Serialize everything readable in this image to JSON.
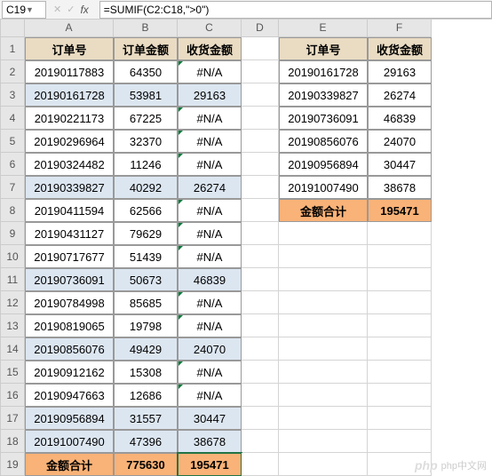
{
  "name_box": "C19",
  "formula": "=SUMIF(C2:C18,\">0\")",
  "cols": [
    "",
    "A",
    "B",
    "C",
    "D",
    "E",
    "F"
  ],
  "rows": [
    "1",
    "2",
    "3",
    "4",
    "5",
    "6",
    "7",
    "8",
    "9",
    "10",
    "11",
    "12",
    "13",
    "14",
    "15",
    "16",
    "17",
    "18",
    "19"
  ],
  "headersA": {
    "A": "订单号",
    "B": "订单金额",
    "C": "收货金额"
  },
  "headersE": {
    "E": "订单号",
    "F": "收货金额"
  },
  "tableA": [
    {
      "a": "20190117883",
      "b": "64350",
      "c": "#N/A",
      "mark": true
    },
    {
      "a": "20190161728",
      "b": "53981",
      "c": "29163",
      "blue": true
    },
    {
      "a": "20190221173",
      "b": "67225",
      "c": "#N/A",
      "mark": true
    },
    {
      "a": "20190296964",
      "b": "32370",
      "c": "#N/A",
      "mark": true
    },
    {
      "a": "20190324482",
      "b": "11246",
      "c": "#N/A",
      "mark": true
    },
    {
      "a": "20190339827",
      "b": "40292",
      "c": "26274",
      "blue": true
    },
    {
      "a": "20190411594",
      "b": "62566",
      "c": "#N/A",
      "mark": true
    },
    {
      "a": "20190431127",
      "b": "79629",
      "c": "#N/A",
      "mark": true
    },
    {
      "a": "20190717677",
      "b": "51439",
      "c": "#N/A",
      "mark": true
    },
    {
      "a": "20190736091",
      "b": "50673",
      "c": "46839",
      "blue": true
    },
    {
      "a": "20190784998",
      "b": "85685",
      "c": "#N/A",
      "mark": true
    },
    {
      "a": "20190819065",
      "b": "19798",
      "c": "#N/A",
      "mark": true
    },
    {
      "a": "20190856076",
      "b": "49429",
      "c": "24070",
      "blue": true
    },
    {
      "a": "20190912162",
      "b": "15308",
      "c": "#N/A",
      "mark": true
    },
    {
      "a": "20190947663",
      "b": "12686",
      "c": "#N/A",
      "mark": true
    },
    {
      "a": "20190956894",
      "b": "31557",
      "c": "30447",
      "blue": true
    },
    {
      "a": "20191007490",
      "b": "47396",
      "c": "38678",
      "blue": true
    }
  ],
  "sumA": {
    "label": "金额合计",
    "b": "775630",
    "c": "195471"
  },
  "tableE": [
    {
      "e": "20190161728",
      "f": "29163"
    },
    {
      "e": "20190339827",
      "f": "26274"
    },
    {
      "e": "20190736091",
      "f": "46839"
    },
    {
      "e": "20190856076",
      "f": "24070"
    },
    {
      "e": "20190956894",
      "f": "30447"
    },
    {
      "e": "20191007490",
      "f": "38678"
    }
  ],
  "sumE": {
    "label": "金额合计",
    "f": "195471"
  },
  "watermark": "php中文网",
  "chart_data": {
    "type": "table",
    "title": "SUMIF example",
    "left_table": {
      "columns": [
        "订单号",
        "订单金额",
        "收货金额"
      ],
      "rows": [
        [
          "20190117883",
          64350,
          null
        ],
        [
          "20190161728",
          53981,
          29163
        ],
        [
          "20190221173",
          67225,
          null
        ],
        [
          "20190296964",
          32370,
          null
        ],
        [
          "20190324482",
          11246,
          null
        ],
        [
          "20190339827",
          40292,
          26274
        ],
        [
          "20190411594",
          62566,
          null
        ],
        [
          "20190431127",
          79629,
          null
        ],
        [
          "20190717677",
          51439,
          null
        ],
        [
          "20190736091",
          50673,
          46839
        ],
        [
          "20190784998",
          85685,
          null
        ],
        [
          "20190819065",
          19798,
          null
        ],
        [
          "20190856076",
          49429,
          24070
        ],
        [
          "20190912162",
          15308,
          null
        ],
        [
          "20190947663",
          12686,
          null
        ],
        [
          "20190956894",
          31557,
          30447
        ],
        [
          "20191007490",
          47396,
          38678
        ]
      ],
      "totals": {
        "订单金额": 775630,
        "收货金额": 195471
      }
    },
    "right_table": {
      "columns": [
        "订单号",
        "收货金额"
      ],
      "rows": [
        [
          "20190161728",
          29163
        ],
        [
          "20190339827",
          26274
        ],
        [
          "20190736091",
          46839
        ],
        [
          "20190856076",
          24070
        ],
        [
          "20190956894",
          30447
        ],
        [
          "20191007490",
          38678
        ]
      ],
      "totals": {
        "收货金额": 195471
      }
    }
  }
}
